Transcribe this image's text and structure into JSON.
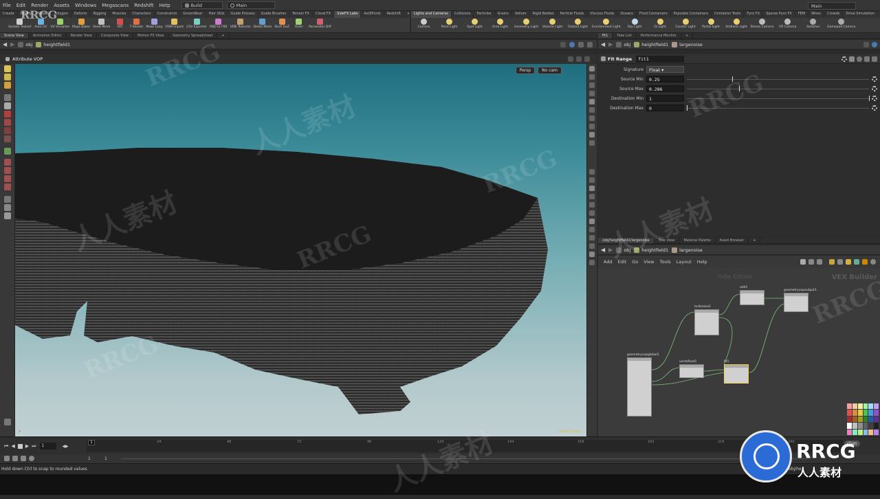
{
  "menu": {
    "items": [
      "File",
      "Edit",
      "Render",
      "Assets",
      "Windows",
      "Megascans",
      "Redshift",
      "Help"
    ],
    "desktop": "Build",
    "workspace": "Main",
    "right_combo": "Main"
  },
  "shelf_tabs_left": [
    "Create",
    "Modify",
    "Model",
    "Polygon",
    "Deform",
    "Rigging",
    "Muscles",
    "Characters",
    "Constraints",
    "GroomBear",
    "Hair Utils",
    "Guide Process",
    "Guide Brushes",
    "Terrain FX",
    "Cloud FX",
    "SideFX Labs",
    "AxiSPLink",
    "Redshift"
  ],
  "shelf_tabs_left_active": "SideFX Labs",
  "shelf_tabs_right": [
    "Lights and Cameras",
    "Collisions",
    "Particles",
    "Grains",
    "Vellum",
    "Rigid Bodies",
    "Particle Fluids",
    "Viscous Fluids",
    "Oceans",
    "Fluid Containers",
    "Populate Containers",
    "Container Tools",
    "Pyro FX",
    "Sparse Pyro FX",
    "FEM",
    "Wires",
    "Crowds",
    "Drive Simulation"
  ],
  "shelf_tools_left": [
    "Update Toolset",
    "Auto UV",
    "UV Visualize",
    "Maps Baker",
    "Voxel Mesh",
    "VAT",
    "T-Sheets",
    "Make Loop",
    "OSM Import",
    "CSV Exporter",
    "RBD to FBX",
    "VDB Textures",
    "Detail Mesh",
    "Start GoZ",
    "Ruler",
    "Parameter Diff"
  ],
  "shelf_tools_right": [
    "Camera",
    "Point Light",
    "Spot Light",
    "Area Light",
    "Geometry Light",
    "Volume Light",
    "Distant Light",
    "Environment Light",
    "Sky Light",
    "GI Light",
    "Caustic Light",
    "Portal Light",
    "Ambient Light",
    "Stereo Camera",
    "VR Camera",
    "Switcher",
    "Gamepad Camera"
  ],
  "left_pane_tabs": [
    "Scene View",
    "Animation Editor",
    "Render View",
    "Composite View",
    "Motion FX View",
    "Geometry Spreadsheet"
  ],
  "left_path": {
    "root": "obj",
    "node": "heightfield1"
  },
  "viewport": {
    "title": "Attribute VOP",
    "persp": "Persp",
    "cam": "No cam",
    "edition": "Indie Edition"
  },
  "parm_pane_tabs": [
    "fit1",
    "Take List",
    "Performance Monitor"
  ],
  "parm_path": {
    "root": "obj",
    "node": "heightfield1",
    "child": "largenoise"
  },
  "parm_header": {
    "type": "Fit Range",
    "name": "fit1"
  },
  "parms": [
    {
      "label": "Signature",
      "value": "Float",
      "kind": "menu"
    },
    {
      "label": "Source Min",
      "value": "0.25",
      "kind": "slider",
      "pos": 0.25
    },
    {
      "label": "Source Max",
      "value": "0.286",
      "kind": "slider",
      "pos": 0.286
    },
    {
      "label": "Destination Min",
      "value": "1",
      "kind": "slider",
      "pos": 1
    },
    {
      "label": "Destination Max",
      "value": "0",
      "kind": "slider",
      "pos": 0
    }
  ],
  "network_tabs": [
    "/obj/heightfield1/largenoise",
    "Tree View",
    "Material Palette",
    "Asset Browser"
  ],
  "network_path": {
    "root": "obj",
    "node": "heightfield1",
    "child": "largenoise"
  },
  "network_menu": [
    "Add",
    "Edit",
    "Go",
    "View",
    "Tools",
    "Layout",
    "Help"
  ],
  "network": {
    "edition": "Indie Edition",
    "context": "VEX Builder",
    "nodes": [
      "add1",
      "geometryvopoutput1",
      "turbnoise1",
      "geometryvopglobal1",
      "vectofloat1",
      "fit1"
    ]
  },
  "timeline": {
    "frame": "1",
    "ticks": [
      "1",
      "24",
      "48",
      "72",
      "96",
      "120",
      "144",
      "168",
      "192",
      "216",
      "240"
    ],
    "start": "1",
    "end": "1",
    "chan": "chan"
  },
  "status": "Hold down Ctrl to snap to rounded values",
  "status_right": "/obj/he",
  "watermark": {
    "brand": "RRCG",
    "cn": "人人素材"
  }
}
